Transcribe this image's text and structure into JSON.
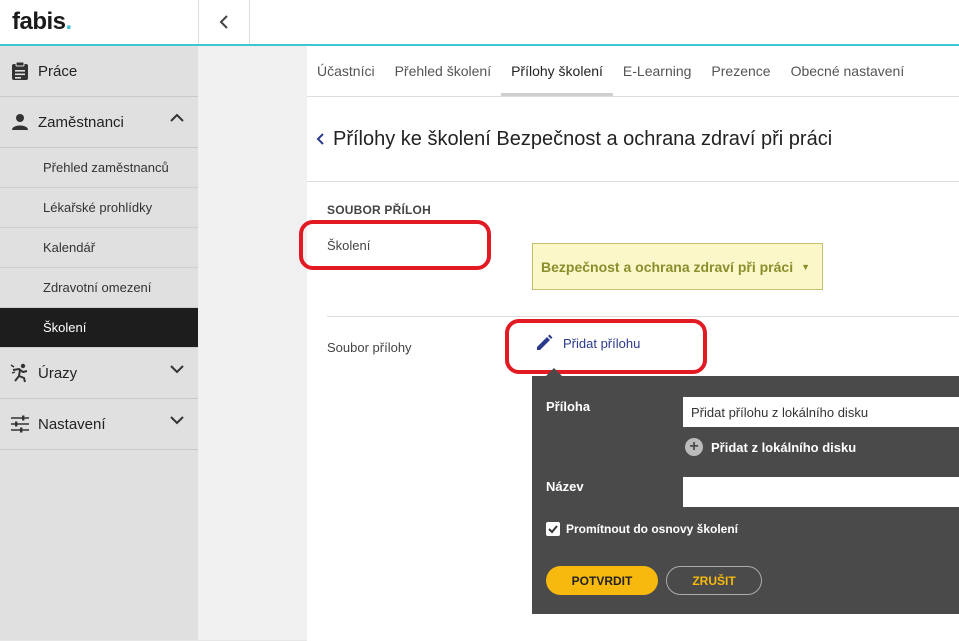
{
  "app": {
    "logo_text": "fabis",
    "logo_dot": ".",
    "accent_color": "#3fc6d4"
  },
  "sidebar": {
    "items": [
      {
        "label": "Práce",
        "icon": "clipboard-icon"
      },
      {
        "label": "Zaměstnanci",
        "icon": "person-icon",
        "expanded": true
      },
      {
        "label": "Úrazy",
        "icon": "injury-icon"
      },
      {
        "label": "Nastavení",
        "icon": "sliders-icon"
      }
    ],
    "sub_items": [
      {
        "label": "Přehled zaměstnanců"
      },
      {
        "label": "Lékařské prohlídky"
      },
      {
        "label": "Kalendář"
      },
      {
        "label": "Zdravotní omezení"
      },
      {
        "label": "Školení",
        "active": true
      }
    ]
  },
  "tabs": [
    {
      "label": "Účastníci"
    },
    {
      "label": "Přehled školení"
    },
    {
      "label": "Přílohy školení",
      "active": true
    },
    {
      "label": "E-Learning"
    },
    {
      "label": "Prezence"
    },
    {
      "label": "Obecné nastavení"
    }
  ],
  "page": {
    "title": "Přílohy ke školení Bezpečnost a ochrana zdraví při práci"
  },
  "form": {
    "section_title": "SOUBOR PŘÍLOH",
    "training_label": "Školení",
    "training_value": "Bezpečnost a ochrana zdraví při práci",
    "attachment_label": "Soubor přílohy",
    "add_attachment": "Přidat přílohu"
  },
  "popover": {
    "attachment_label": "Příloha",
    "attachment_value": "Přidat přílohu z lokálního disku",
    "add_local": "Přidat z lokálního disku",
    "name_label": "Název",
    "name_value": "",
    "checkbox_label": "Promítnout do osnovy školení",
    "checkbox_checked": true,
    "confirm": "POTVRDIT",
    "cancel": "ZRUŠIT"
  }
}
